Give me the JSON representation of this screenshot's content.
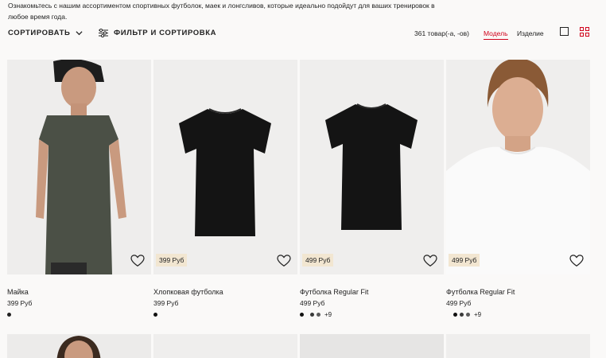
{
  "intro": "Ознакомьтесь с нашим ассортиментом спортивных футболок, маек и лонгсливов, которые идеально подойдут для ваших тренировок в любое время года.",
  "toolbar": {
    "sort_label": "СОРТИРОВАТЬ",
    "filter_label": "ФИЛЬТР И СОРТИРОВКА",
    "count": "361 товар(-а, -ов)",
    "view_model": "Модель",
    "view_item": "Изделие"
  },
  "colors": {
    "accent": "#d0021b",
    "price_tag_bg": "#f2e6d1"
  },
  "products": [
    {
      "name": "Майка",
      "price": "399 Руб",
      "tag": "",
      "swatches": [
        "#222222"
      ],
      "more": ""
    },
    {
      "name": "Хлопковая футболка",
      "price": "399 Руб",
      "tag": "399 Руб",
      "swatches": [
        "#111111"
      ],
      "more": ""
    },
    {
      "name": "Футболка Regular Fit",
      "price": "499 Руб",
      "tag": "499 Руб",
      "swatches": [
        "#111111",
        "#3a3a3a",
        "#5b5b5b"
      ],
      "more": "+9"
    },
    {
      "name": "Футболка Regular Fit",
      "price": "499 Руб",
      "tag": "499 Руб",
      "swatches": [
        "#111111",
        "#3a3a3a",
        "#5b5b5b"
      ],
      "more": "+9"
    }
  ]
}
